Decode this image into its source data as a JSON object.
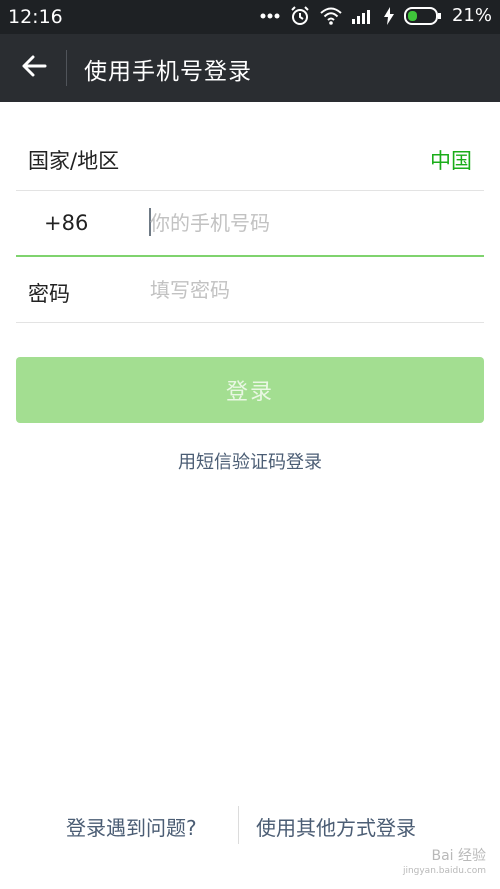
{
  "status_bar": {
    "time": "12:16",
    "battery": "21%",
    "icons": [
      "more-dots-icon",
      "alarm-icon",
      "wifi-icon",
      "signal-icon",
      "charging-icon",
      "battery-icon"
    ]
  },
  "header": {
    "back_icon": "back-arrow-icon",
    "title": "使用手机号登录"
  },
  "form": {
    "country_label": "国家/地区",
    "country_value": "中国",
    "phone_code": "+86",
    "phone_placeholder": "你的手机号码",
    "phone_value": "",
    "password_label": "密码",
    "password_placeholder": "填写密码",
    "password_value": ""
  },
  "actions": {
    "login_label": "登录",
    "sms_login_link": "用短信验证码登录"
  },
  "footer": {
    "problem_link": "登录遇到问题?",
    "other_methods_link": "使用其他方式登录"
  },
  "watermark": {
    "text": "Bai 经验",
    "sub": "jingyan.baidu.com"
  },
  "colors": {
    "accent": "#1aad19",
    "button_disabled": "#a3de91",
    "link": "#4b5d74",
    "header_bg": "#2a2d31"
  }
}
